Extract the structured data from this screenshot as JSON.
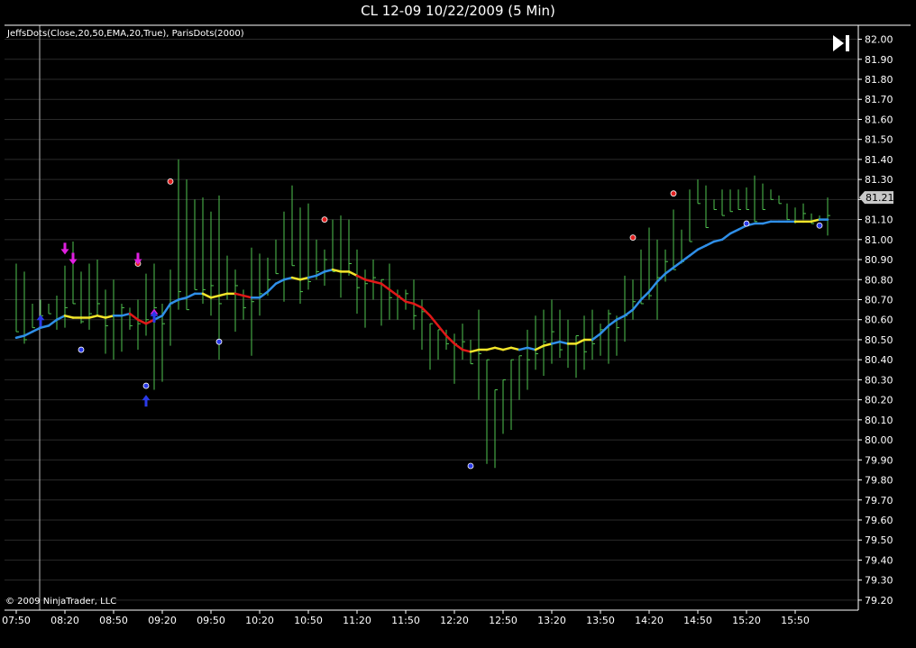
{
  "title": "CL 12-09  10/22/2009 (5 Min)",
  "indicator_label": "JeffsDots(Close,20,50,EMA,20,True), ParisDots(2000)",
  "copyright": "© 2009 NinjaTrader, LLC",
  "last_price": "81.21",
  "colors": {
    "background": "#000000",
    "grid": "#2a2a2a",
    "bars": "#4fc34f",
    "ma_up": "#2f8fe8",
    "ma_flat": "#f2e52a",
    "ma_down": "#e01818",
    "arrow": "#e020e0",
    "dot_high": "#e02020",
    "dot_low": "#2a3ae8"
  },
  "chart_data": {
    "type": "ohlc",
    "title": "CL 12-09  10/22/2009 (5 Min)",
    "ylim": [
      79.15,
      82.07
    ],
    "y_ticks": [
      "82.00",
      "81.90",
      "81.80",
      "81.70",
      "81.60",
      "81.50",
      "81.40",
      "81.30",
      "81.20",
      "81.10",
      "81.00",
      "80.90",
      "80.80",
      "80.70",
      "80.60",
      "80.50",
      "80.40",
      "80.30",
      "80.20",
      "80.10",
      "80.00",
      "79.90",
      "79.80",
      "79.70",
      "79.60",
      "79.50",
      "79.40",
      "79.30",
      "79.20"
    ],
    "x_ticks": [
      "07:50",
      "08:20",
      "08:50",
      "09:20",
      "09:50",
      "10:20",
      "10:50",
      "11:20",
      "11:50",
      "12:20",
      "12:50",
      "13:20",
      "13:50",
      "14:20",
      "14:50",
      "15:20",
      "15:50"
    ],
    "x": [
      "07:50",
      "07:55",
      "08:00",
      "08:05",
      "08:10",
      "08:15",
      "08:20",
      "08:25",
      "08:30",
      "08:35",
      "08:40",
      "08:45",
      "08:50",
      "08:55",
      "09:00",
      "09:05",
      "09:10",
      "09:15",
      "09:20",
      "09:25",
      "09:30",
      "09:35",
      "09:40",
      "09:45",
      "09:50",
      "09:55",
      "10:00",
      "10:05",
      "10:10",
      "10:15",
      "10:20",
      "10:25",
      "10:30",
      "10:35",
      "10:40",
      "10:45",
      "10:50",
      "10:55",
      "11:00",
      "11:05",
      "11:10",
      "11:15",
      "11:20",
      "11:25",
      "11:30",
      "11:35",
      "11:40",
      "11:45",
      "11:50",
      "11:55",
      "12:00",
      "12:05",
      "12:10",
      "12:15",
      "12:20",
      "12:25",
      "12:30",
      "12:35",
      "12:40",
      "12:45",
      "12:50",
      "12:55",
      "13:00",
      "13:05",
      "13:10",
      "13:15",
      "13:20",
      "13:25",
      "13:30",
      "13:35",
      "13:40",
      "13:45",
      "13:50",
      "13:55",
      "14:00",
      "14:05",
      "14:10",
      "14:15",
      "14:20",
      "14:25",
      "14:30",
      "14:35",
      "14:40",
      "14:45",
      "14:50",
      "14:55",
      "15:00",
      "15:05",
      "15:10",
      "15:15",
      "15:20",
      "15:25",
      "15:30",
      "15:35",
      "15:40",
      "15:45",
      "15:50",
      "15:55",
      "16:00",
      "16:05",
      "16:10"
    ],
    "high": [
      80.88,
      80.84,
      80.68,
      80.7,
      80.68,
      80.72,
      80.87,
      80.99,
      80.84,
      80.88,
      80.9,
      80.75,
      80.8,
      80.68,
      80.66,
      80.7,
      80.83,
      80.88,
      80.68,
      80.85,
      81.4,
      81.3,
      81.2,
      81.21,
      81.14,
      81.22,
      80.92,
      80.85,
      80.75,
      80.96,
      80.93,
      80.91,
      81.0,
      81.14,
      81.27,
      81.16,
      81.18,
      81.0,
      80.95,
      81.1,
      81.12,
      81.1,
      80.95,
      80.85,
      80.9,
      80.8,
      80.88,
      80.75,
      80.75,
      80.8,
      80.7,
      80.58,
      80.55,
      80.55,
      80.53,
      80.58,
      80.5,
      80.65,
      80.4,
      80.25,
      80.3,
      80.4,
      80.42,
      80.55,
      80.62,
      80.65,
      80.7,
      80.65,
      80.6,
      80.52,
      80.62,
      80.65,
      80.58,
      80.65,
      80.62,
      80.82,
      80.8,
      80.95,
      81.06,
      81.0,
      80.95,
      81.15,
      81.05,
      81.25,
      81.3,
      81.27,
      81.2,
      81.25,
      81.25,
      81.25,
      81.26,
      81.32,
      81.28,
      81.25,
      81.22,
      81.18,
      81.16,
      81.18,
      81.13,
      81.12,
      81.21
    ],
    "low": [
      80.54,
      80.48,
      80.56,
      80.62,
      80.63,
      80.55,
      80.56,
      80.68,
      80.58,
      80.55,
      80.62,
      80.43,
      80.4,
      80.44,
      80.55,
      80.45,
      80.52,
      80.25,
      80.29,
      80.47,
      80.65,
      80.65,
      80.75,
      80.68,
      80.62,
      80.4,
      80.7,
      80.54,
      80.6,
      80.42,
      80.62,
      80.72,
      80.83,
      80.69,
      80.87,
      80.68,
      80.75,
      80.8,
      80.77,
      80.84,
      80.71,
      80.82,
      80.63,
      80.56,
      80.7,
      80.57,
      80.6,
      80.6,
      80.65,
      80.55,
      80.45,
      80.35,
      80.4,
      80.45,
      80.28,
      80.4,
      80.38,
      80.2,
      79.88,
      79.86,
      80.03,
      80.05,
      80.2,
      80.25,
      80.35,
      80.32,
      80.38,
      80.41,
      80.36,
      80.31,
      80.35,
      80.4,
      80.42,
      80.38,
      80.42,
      80.49,
      80.6,
      80.68,
      80.7,
      80.6,
      80.79,
      80.85,
      80.88,
      80.99,
      81.18,
      81.06,
      81.15,
      81.12,
      81.14,
      81.15,
      81.15,
      81.09,
      81.15,
      81.2,
      81.18,
      81.1,
      81.08,
      81.1,
      81.08,
      81.1,
      81.02
    ],
    "ma": [
      80.51,
      80.52,
      80.54,
      80.56,
      80.57,
      80.6,
      80.62,
      80.61,
      80.61,
      80.61,
      80.62,
      80.61,
      80.62,
      80.62,
      80.63,
      80.6,
      80.58,
      80.6,
      80.62,
      80.68,
      80.7,
      80.71,
      80.73,
      80.73,
      80.71,
      80.72,
      80.73,
      80.73,
      80.72,
      80.71,
      80.71,
      80.74,
      80.78,
      80.8,
      80.81,
      80.8,
      80.81,
      80.82,
      80.84,
      80.85,
      80.84,
      80.84,
      80.82,
      80.8,
      80.79,
      80.78,
      80.75,
      80.72,
      80.69,
      80.68,
      80.66,
      80.62,
      80.57,
      80.52,
      80.48,
      80.45,
      80.44,
      80.45,
      80.45,
      80.46,
      80.45,
      80.46,
      80.45,
      80.46,
      80.45,
      80.47,
      80.48,
      80.49,
      80.48,
      80.48,
      80.5,
      80.5,
      80.53,
      80.57,
      80.6,
      80.62,
      80.65,
      80.7,
      80.74,
      80.79,
      80.83,
      80.86,
      80.89,
      80.92,
      80.95,
      80.97,
      80.99,
      81.0,
      81.03,
      81.05,
      81.07,
      81.08,
      81.08,
      81.09,
      81.09,
      81.09,
      81.09,
      81.09,
      81.09,
      81.1,
      81.1
    ],
    "ma_color": [
      "up",
      "up",
      "up",
      "up",
      "up",
      "up",
      "flat",
      "flat",
      "flat",
      "flat",
      "flat",
      "flat",
      "up",
      "up",
      "down",
      "down",
      "down",
      "up",
      "up",
      "up",
      "up",
      "up",
      "up",
      "flat",
      "flat",
      "flat",
      "flat",
      "down",
      "down",
      "up",
      "up",
      "up",
      "up",
      "up",
      "flat",
      "flat",
      "up",
      "up",
      "up",
      "flat",
      "flat",
      "flat",
      "down",
      "down",
      "down",
      "down",
      "down",
      "down",
      "down",
      "down",
      "down",
      "down",
      "down",
      "down",
      "down",
      "down",
      "flat",
      "flat",
      "flat",
      "flat",
      "flat",
      "flat",
      "up",
      "up",
      "flat",
      "flat",
      "up",
      "up",
      "flat",
      "flat",
      "flat",
      "up",
      "up",
      "up",
      "up",
      "up",
      "up",
      "up",
      "up",
      "up",
      "up",
      "up",
      "up",
      "up",
      "up",
      "up",
      "up",
      "up",
      "up",
      "up",
      "up",
      "up",
      "up",
      "up",
      "up",
      "up",
      "flat",
      "flat",
      "flat",
      "up",
      "up"
    ],
    "dots": [
      {
        "x": "08:30",
        "y": 80.45,
        "kind": "low"
      },
      {
        "x": "09:05",
        "y": 80.88,
        "kind": "high"
      },
      {
        "x": "09:10",
        "y": 80.27,
        "kind": "low"
      },
      {
        "x": "09:25",
        "y": 81.29,
        "kind": "high"
      },
      {
        "x": "09:55",
        "y": 80.49,
        "kind": "low"
      },
      {
        "x": "11:00",
        "y": 81.1,
        "kind": "high"
      },
      {
        "x": "12:30",
        "y": 79.87,
        "kind": "low"
      },
      {
        "x": "14:10",
        "y": 81.01,
        "kind": "high"
      },
      {
        "x": "14:35",
        "y": 81.23,
        "kind": "high"
      },
      {
        "x": "15:20",
        "y": 81.08,
        "kind": "low"
      },
      {
        "x": "16:05",
        "y": 81.07,
        "kind": "low"
      }
    ],
    "arrows": [
      {
        "x": "08:20",
        "y": 80.93,
        "dir": "down",
        "color": "magenta"
      },
      {
        "x": "08:25",
        "y": 80.88,
        "dir": "down",
        "color": "magenta"
      },
      {
        "x": "09:05",
        "y": 80.88,
        "dir": "down",
        "color": "magenta"
      },
      {
        "x": "08:05",
        "y": 80.62,
        "dir": "up",
        "color": "blue"
      },
      {
        "x": "09:10",
        "y": 80.22,
        "dir": "up",
        "color": "blue"
      },
      {
        "x": "09:15",
        "y": 80.65,
        "dir": "up",
        "color": "magenta"
      },
      {
        "x": "09:15",
        "y": 80.64,
        "dir": "up",
        "color": "blue"
      }
    ]
  }
}
